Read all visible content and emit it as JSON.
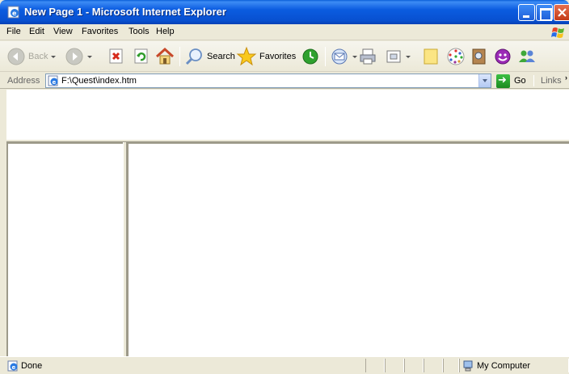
{
  "window": {
    "title": "New Page 1 - Microsoft Internet Explorer"
  },
  "menu": {
    "items": [
      "File",
      "Edit",
      "View",
      "Favorites",
      "Tools",
      "Help"
    ]
  },
  "toolbar": {
    "back_label": "Back",
    "search_label": "Search",
    "favorites_label": "Favorites"
  },
  "address": {
    "label": "Address",
    "value": "F:\\Quest\\index.htm",
    "go_label": "Go",
    "links_label": "Links"
  },
  "status": {
    "text": "Done",
    "zone": "My Computer"
  },
  "colors": {
    "titlebar": "#0b5ce0",
    "chrome": "#ece9d8",
    "close_button": "#c43a17"
  }
}
